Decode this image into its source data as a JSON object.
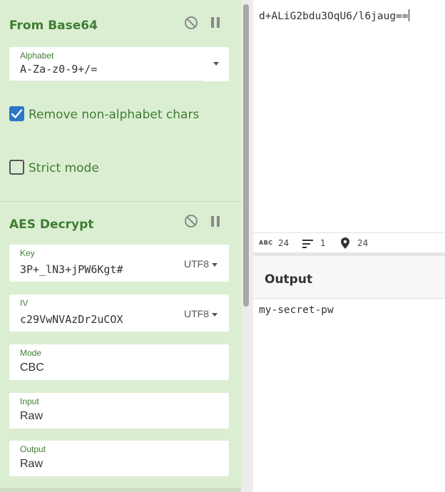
{
  "recipe": {
    "from_base64": {
      "title": "From Base64",
      "alphabet": {
        "label": "Alphabet",
        "value": "A-Za-z0-9+/="
      },
      "remove_non_alphabet": {
        "label": "Remove non-alphabet chars",
        "checked": true
      },
      "strict_mode": {
        "label": "Strict mode",
        "checked": false
      }
    },
    "aes_decrypt": {
      "title": "AES Decrypt",
      "key": {
        "label": "Key",
        "value": "3P+_lN3+jPW6Kgt#",
        "encoding": "UTF8"
      },
      "iv": {
        "label": "IV",
        "value": "c29VwNVAzDr2uCOX",
        "encoding": "UTF8"
      },
      "mode": {
        "label": "Mode",
        "value": "CBC"
      },
      "input": {
        "label": "Input",
        "value": "Raw"
      },
      "output": {
        "label": "Output",
        "value": "Raw"
      }
    }
  },
  "input": {
    "text": "d+ALiG2bdu3OqU6/l6jaug==",
    "stats": {
      "length": "24",
      "lines": "1",
      "position": "24"
    }
  },
  "output": {
    "title": "Output",
    "text": "my-secret-pw"
  },
  "colors": {
    "recipe_bg": "#dbeed2",
    "accent_green": "#3f7d33",
    "checkbox_blue": "#2d75c6"
  }
}
